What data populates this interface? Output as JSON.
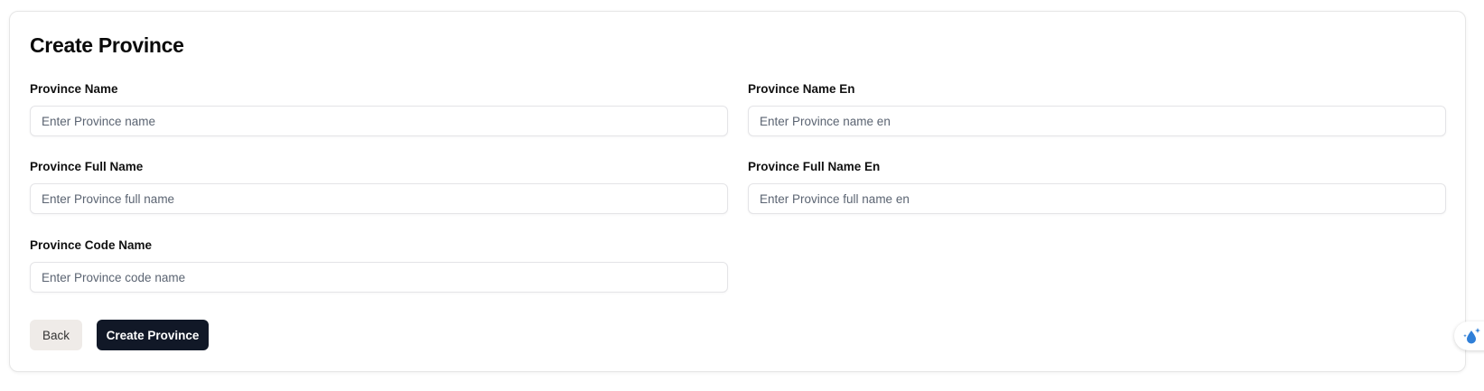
{
  "page": {
    "title": "Create Province"
  },
  "form": {
    "province_name": {
      "label": "Province Name",
      "placeholder": "Enter Province name",
      "value": ""
    },
    "province_name_en": {
      "label": "Province Name En",
      "placeholder": "Enter Province name en",
      "value": ""
    },
    "province_full_name": {
      "label": "Province Full Name",
      "placeholder": "Enter Province full name",
      "value": ""
    },
    "province_full_name_en": {
      "label": "Province Full Name En",
      "placeholder": "Enter Province full name en",
      "value": ""
    },
    "province_code_name": {
      "label": "Province Code Name",
      "placeholder": "Enter Province code name",
      "value": ""
    }
  },
  "actions": {
    "back_label": "Back",
    "create_label": "Create Province"
  },
  "widget": {
    "icon": "water-drop-sparkle-icon",
    "accent": "#2f7fd8"
  },
  "colors": {
    "primary_button": "#111827",
    "secondary_button": "#efebe8"
  }
}
